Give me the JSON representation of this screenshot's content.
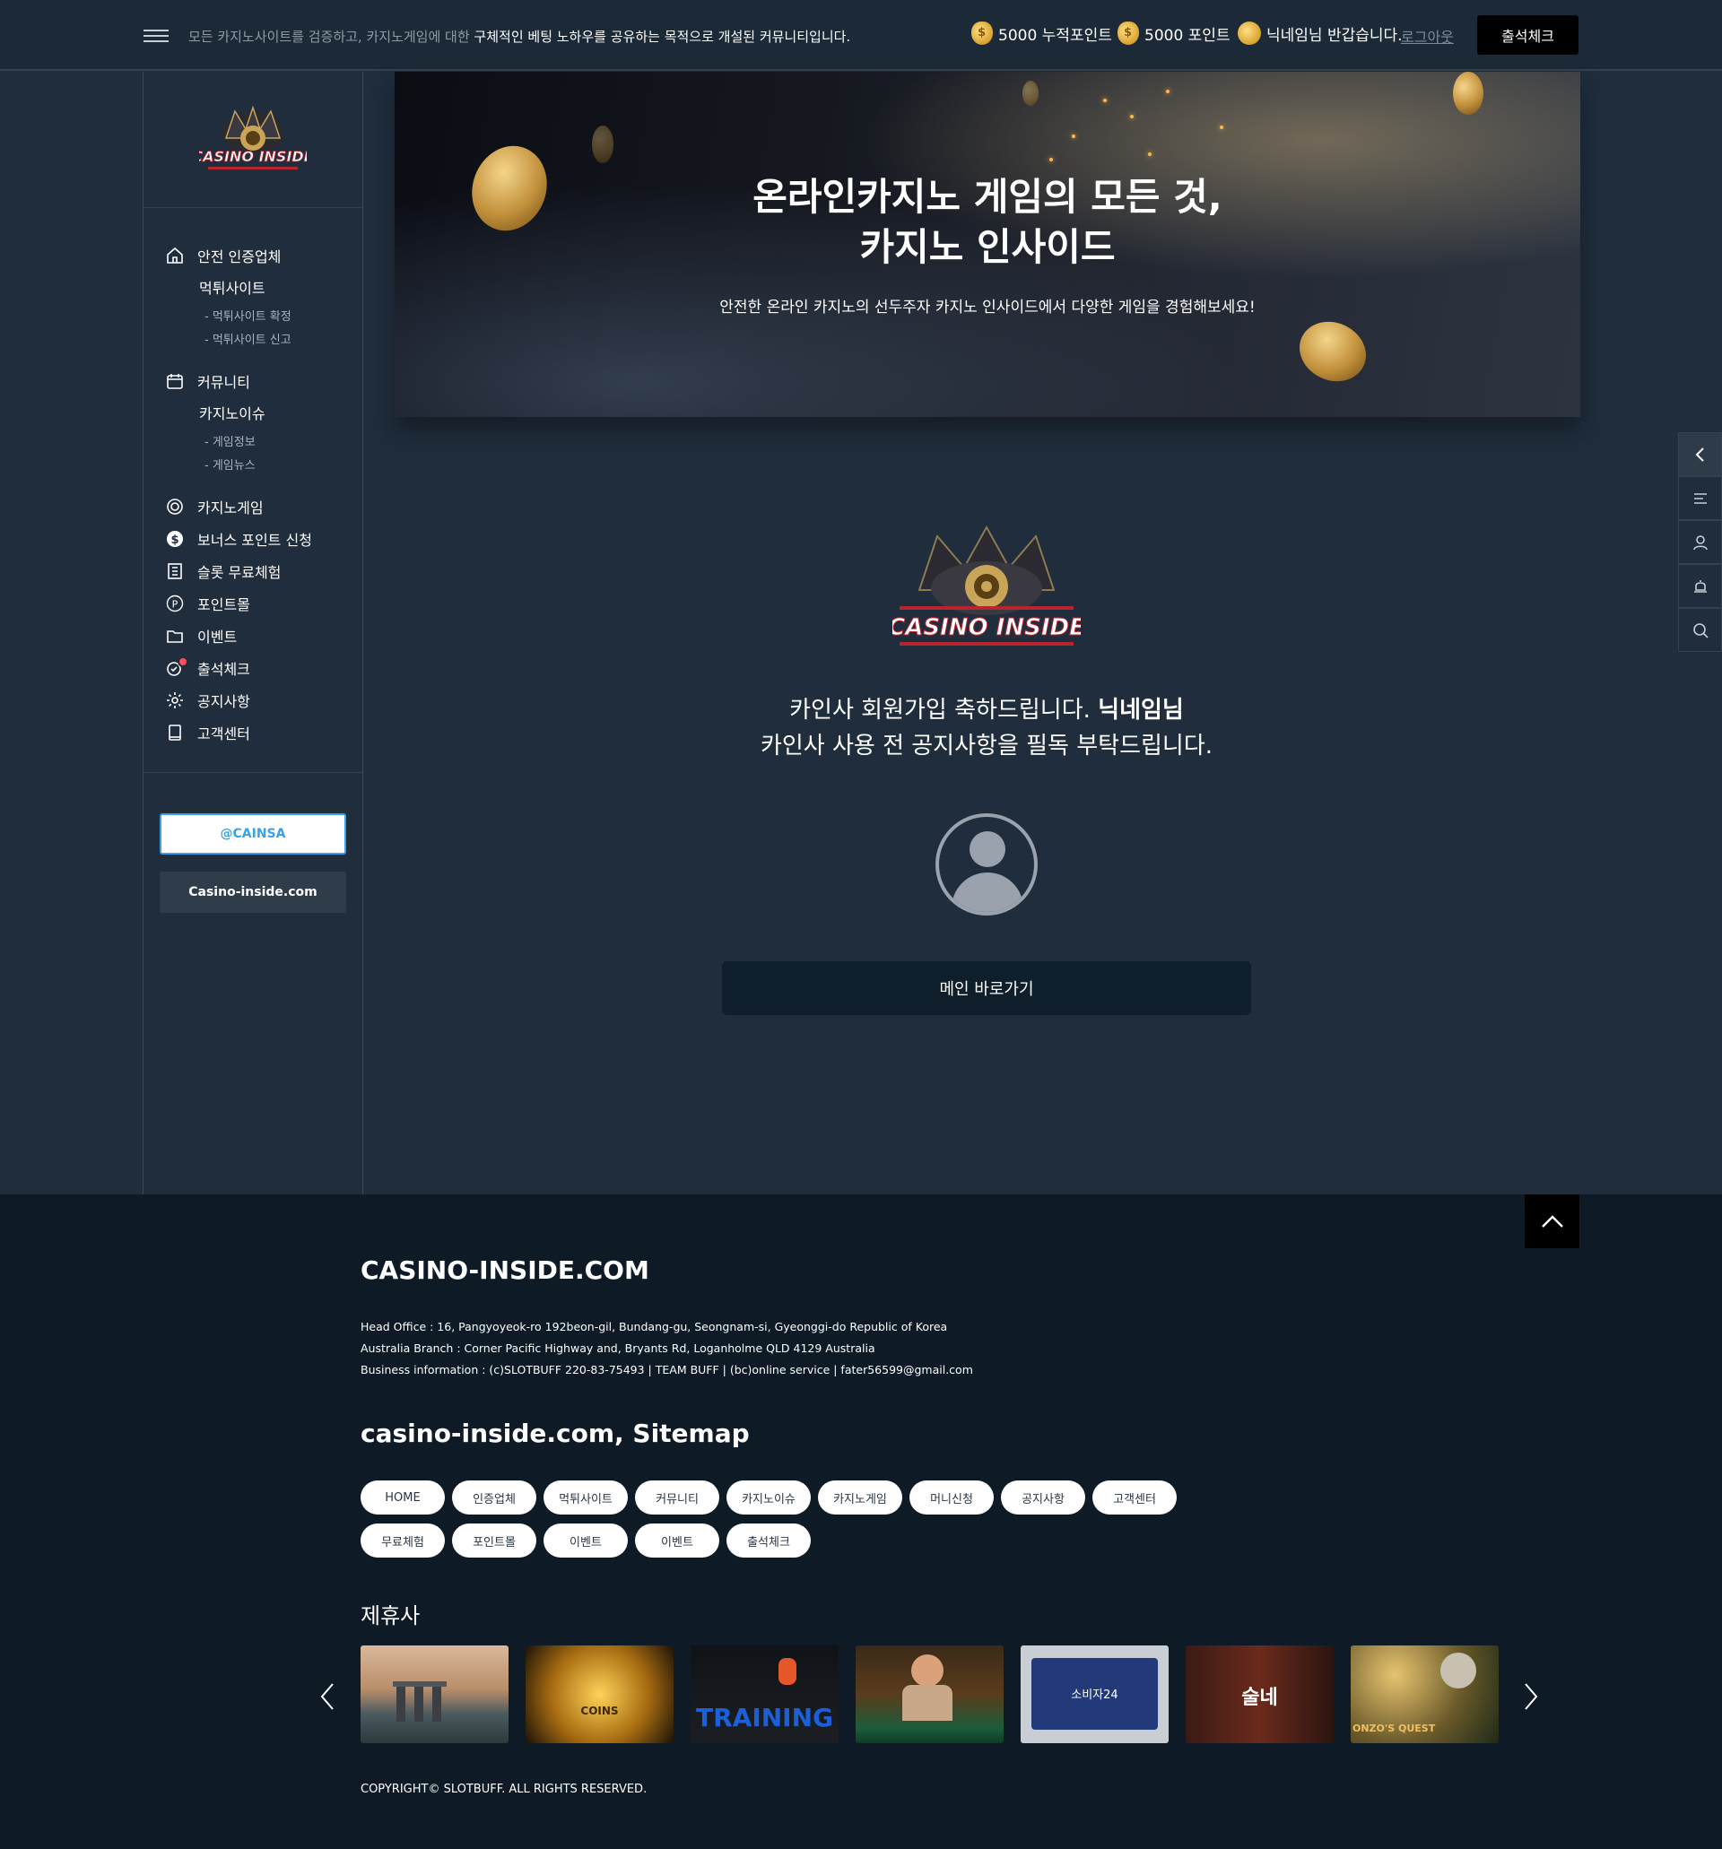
{
  "topbar": {
    "tagline_prefix": "모든 카지노사이트를 검증하고, 카지노게임에 대한 ",
    "tagline_bold": "구체적인 베팅 노하우를 공유하는 목적으로 개설된 커뮤니티입니다.",
    "accum_points": "5000 누적포인트",
    "points": "5000 포인트",
    "greeting": "닉네임님 반갑습니다.",
    "logout": "로그아웃",
    "checkin": "출석체크"
  },
  "sidebar": {
    "logo_text": "CASINO INSIDE",
    "items": [
      {
        "label": "안전 인증업체",
        "icon": "home-icon"
      },
      {
        "label": "먹튀사이트"
      },
      {
        "label": "- 먹튀사이트 확정"
      },
      {
        "label": "- 먹튀사이트 신고"
      },
      {
        "label": "커뮤니티",
        "icon": "calendar-icon"
      },
      {
        "label": "카지노이슈"
      },
      {
        "label": "- 게임정보"
      },
      {
        "label": "- 게임뉴스"
      },
      {
        "label": "카지노게임",
        "icon": "chip-icon"
      },
      {
        "label": "보너스 포인트 신청",
        "icon": "dollar-icon"
      },
      {
        "label": "슬롯 무료체험",
        "icon": "building-icon"
      },
      {
        "label": "포인트몰",
        "icon": "p-circle-icon"
      },
      {
        "label": "이벤트",
        "icon": "folder-icon"
      },
      {
        "label": "출석체크",
        "icon": "check-in-icon"
      },
      {
        "label": "공지사항",
        "icon": "gear-icon"
      },
      {
        "label": "고객센터",
        "icon": "book-icon"
      }
    ],
    "telegram": "@CAINSA",
    "site": "Casino-inside.com"
  },
  "hero": {
    "title_line1": "온라인카지노 게임의 모든 것,",
    "title_line2": "카지노 인사이드",
    "subtitle": "안전한 온라인 카지노의 선두주자 카지노 인사이드에서 다양한 게임을 경험해보세요!"
  },
  "welcome": {
    "logo_text": "CASINO INSIDE",
    "line1_prefix": "카인사 회원가입 축하드립니다. ",
    "line1_bold": "닉네임님",
    "line2": "카인사 사용 전 공지사항을 필독 부탁드립니다.",
    "main_button": "메인 바로가기"
  },
  "float_menu": [
    "chevron-left-icon",
    "menu-icon",
    "user-icon",
    "bell-icon",
    "search-icon"
  ],
  "footer": {
    "brand": "CASINO-INSIDE.COM",
    "info": [
      "Head Office : 16, Pangyoyeok-ro 192beon-gil, Bundang-gu, Seongnam-si, Gyeonggi-do Republic of Korea",
      "Australia Branch : Corner Pacific Highway and, Bryants Rd, Loganholme QLD 4129 Australia",
      "Business information : (c)SLOTBUFF 220-83-75493 | TEAM BUFF | (bc)online service | fater56599@gmail.com"
    ],
    "sitemap_title": "casino-inside.com, Sitemap",
    "sitemap": [
      "HOME",
      "인증업체",
      "먹튀사이트",
      "커뮤니티",
      "카지노이슈",
      "카지노게임",
      "머니신청",
      "공지사항",
      "고객센터",
      "무료체험",
      "포인트몰",
      "이벤트",
      "이벤트",
      "출석체크"
    ],
    "partners_title": "제휴사",
    "partners": [
      {
        "label": ""
      },
      {
        "label": "COINS"
      },
      {
        "label": "TRAINING"
      },
      {
        "label": ""
      },
      {
        "label": "소비자24"
      },
      {
        "label": "술네"
      },
      {
        "label": "ONZO'S QUEST"
      }
    ],
    "copyright": "COPYRIGHT© SLOTBUFF. ALL RIGHTS RESERVED."
  }
}
